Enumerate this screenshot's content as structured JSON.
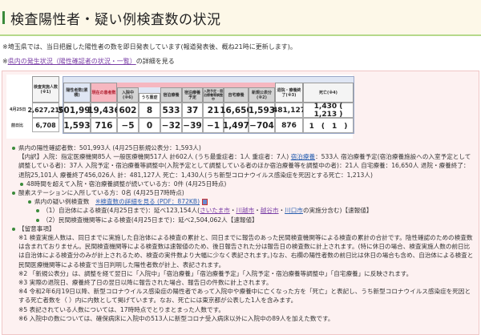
{
  "title": "検査陽性者・疑い例検査数の状況",
  "note1": "※埼玉県では、当日把握した陽性者の数を即日発表しています(報道発表後、概ね21時に更新します)。",
  "note2_prefix": "※",
  "note2_link": "県内の発生状況（陽性確認者の状況・一覧）",
  "note2_suffix": "の詳細を見る",
  "table": {
    "row_labels": [
      "4月25日",
      "前日比"
    ],
    "headers": {
      "tests": "検査実施人数(※1)",
      "positives": "陽性者数(累積)",
      "current": "現在の患者数",
      "hospitalized": "入院中(※6)",
      "severe": "うち重症",
      "hotel": "宿泊療養",
      "hotel_planned": "宿泊療養予定",
      "adjusting": "入院予定・宿泊療養等調整中",
      "home": "自宅療養",
      "new": "新規公表分(※2)",
      "recovered": "退院・療養終了(※3)",
      "deaths": "死亡(※4)"
    },
    "today": {
      "tests": "2,627,216",
      "positives": "501,993",
      "current": "19,436",
      "hospitalized": "602",
      "severe": "8",
      "hotel": "533",
      "hotel_planned": "37",
      "adjusting": "21",
      "home": "16,650",
      "new": "1,593",
      "recovered": "481,127",
      "deaths": "1,430 ( 1,213 )"
    },
    "diff": {
      "tests": "6,708",
      "positives": "1,593",
      "current": "716",
      "hospitalized": "−5",
      "severe": "0",
      "hotel": "−32",
      "hotel_planned": "−39",
      "adjusting": "−1",
      "home": "1,497",
      "new": "−704",
      "recovered": "876",
      "deaths": "1　(　1　)"
    }
  },
  "summary": {
    "line1": "県内の陽性確認者数：501,993人 (4月25日新規公表分：1,593人)",
    "detail_a": "【内訳】入院：指定医療機関85人 一般医療機関517人 計602人 (うち最重症者：1人 重症者：7人) ",
    "detail_link": "宿泊療養",
    "detail_b": "：533人 宿泊療養予定(宿泊療養施設への入室予定として調整している者)：37人 入院予定・宿泊療養等調整中(入院予定として調整している者のほか宿泊療養等を調整中の者)：21人 自宅療養：16,650人 退院・療養終了：退院25,101人 療養終了456,026人 計：481,127人 死亡：1,430人(うち新型コロナウイルス感染症を死因とする死亡：1,213人)",
    "line48": "48時間を超えて入院・宿泊療養調整が続いている方：0件 (4月25日時点)",
    "oxygen": "酸素ステーションに入所している方：0名 (4月25日7時時点)",
    "suspect_label": "県内の疑い例検査数",
    "suspect_link": "※検査数の詳細を見る (PDF：872KB)",
    "local_a": "（1）自治体による検査(4月25日まで)：延べ123,154人(",
    "cities": [
      "さいたま市",
      "川越市",
      "越谷市",
      "川口市"
    ],
    "local_b": "の実施分含む)【速報値】",
    "private": "（2）民間検査機関等による検査(4月25日まで)：延べ2,504,062人【速報値】"
  },
  "notes": {
    "heading": "【留意事項】",
    "n1": "※1 検査実施人数は、同日までに実施した自治体による検査の累計と、同日までに報告のあった民間検査機関等による検査の累計の合計です。陰性確認のための検査数は含まれておりません。民間検査機関等による検査数は速報値のため、後日報告された分は報告日の検査数に計上されます。(特に休日の場合、検査実施人数の前日比は自治体による検査分のみが計上されるため、検査の実件数より大幅に少なく表記されます。)なお、右欄の陽性者数の前日比は休日の場合も含め、自治体による検査と民間医療機関等による検査で当日判明した陽性者数が計上、表記されます。",
    "n2": "※2 「新規公表分」は、調整を経て翌日に「入院中」「宿泊療養」「宿泊療養予定」「入院予定・宿泊療養等調整中」「自宅療養」に反映されます。",
    "n3": "※3 実際の退院日、療養終了日の翌日以降に報告された場合、報告日の件数に計上されます。",
    "n4": "※4 令和2年6月19日以降、新型コロナウイルス感染症の陽性者であって入院中や療養中に亡くなった方を「死亡」と表記し、うち新型コロナウイルス感染症を死因とする死亡者数を（ ）内に内数として掲げています。なお、死亡には東京都が公表した1人を含みます。",
    "n5": "※5 表記されている人数については、17時時点でとりまとまった人数です。",
    "n6": "※6 入院中の数については、確保病床に入院中の513人に新型コロナ受入病床以外に入院中の89人を加えた数です。"
  }
}
